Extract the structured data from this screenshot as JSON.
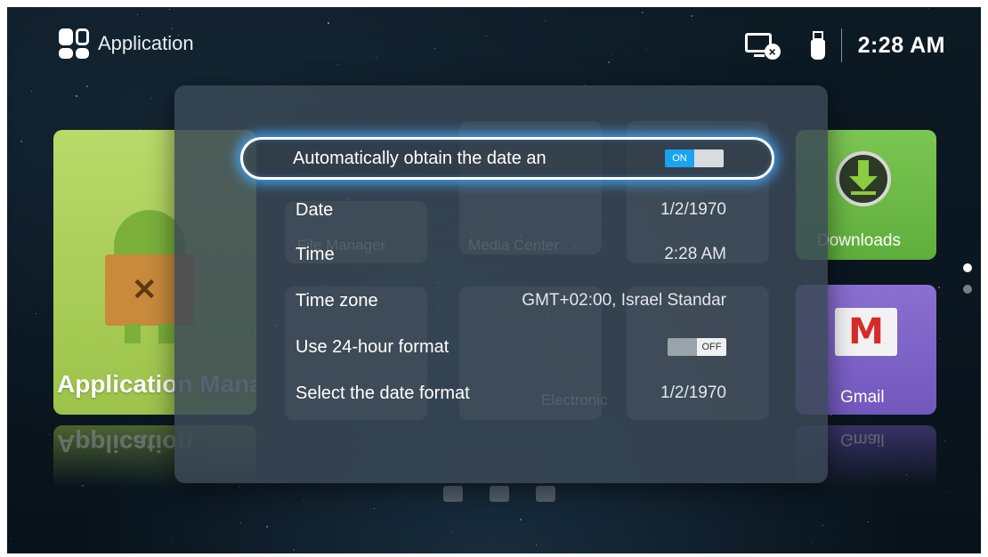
{
  "header": {
    "section_title": "Application",
    "clock": "2:28 AM",
    "icons": [
      "grid-icon",
      "network-disconnected-icon",
      "usb-icon"
    ]
  },
  "background_tiles": {
    "app_manager": {
      "label": "Application Manager",
      "reflection": "Application"
    },
    "downloads": {
      "label": "Downloads"
    },
    "gmail": {
      "label": "Gmail",
      "reflection": "Gmail"
    },
    "ghost_labels": [
      "File Manager",
      "Media Center",
      "Electronic"
    ]
  },
  "dialog": {
    "rows": [
      {
        "label": "Automatically obtain the date an",
        "toggle": "ON",
        "toggle_state": true
      },
      {
        "label": "Date",
        "value": "1/2/1970"
      },
      {
        "label": "Time",
        "value": "2:28 AM"
      },
      {
        "label": "Time zone",
        "value": "GMT+02:00, Israel Standar"
      },
      {
        "label": "Use 24-hour format",
        "toggle": "OFF",
        "toggle_state": false
      },
      {
        "label": "Select the date format",
        "value": "1/2/1970"
      }
    ]
  },
  "colors": {
    "toggle_on": "#1aa3f0",
    "focus_glow": "#46aaff",
    "app_manager_tile": "#9cc34a",
    "downloads_tile": "#5fae3c",
    "gmail_tile": "#7258bd"
  }
}
